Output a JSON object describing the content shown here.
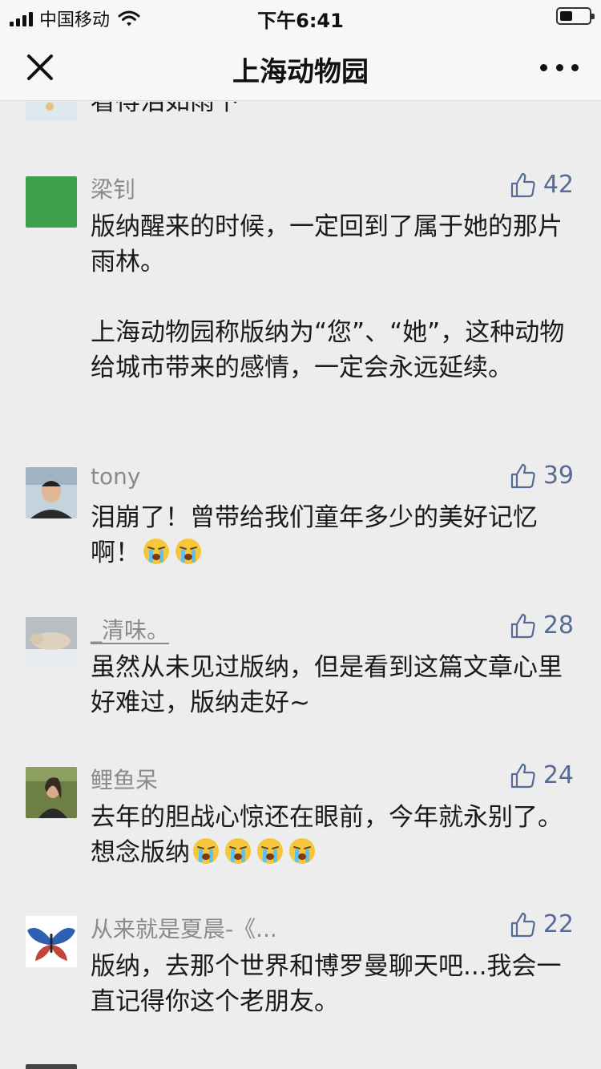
{
  "status_bar": {
    "carrier": "中国移动",
    "time": "下午6:41",
    "battery_percent": 42
  },
  "nav": {
    "title": "上海动物园"
  },
  "colors": {
    "accent": "#576b95",
    "background": "#ededed",
    "name_gray": "#8a8a8a"
  },
  "comments": [
    {
      "name": "",
      "likes": "",
      "text": "看得泪如雨下",
      "avatar_icon": "avatar-photo"
    },
    {
      "name": "梁钊",
      "likes": "42",
      "text": "版纳醒来的时候，一定回到了属于她的那片雨林。\n\n上海动物园称版纳为“您”、“她”，这种动物给城市带来的感情，一定会永远延续。",
      "avatar_icon": "green-square-avatar"
    },
    {
      "name": "tony",
      "likes": "39",
      "text": "泪崩了！曾带给我们童年多少的美好记忆啊！",
      "emoji_count": 2,
      "avatar_icon": "avatar-photo"
    },
    {
      "name": "_清味。",
      "likes": "28",
      "text": "虽然从未见过版纳，但是看到这篇文章心里好难过，版纳走好~",
      "avatar_icon": "avatar-photo"
    },
    {
      "name": "鲤鱼呆",
      "likes": "24",
      "text": "去年的胆战心惊还在眼前，今年就永别了。想念版纳",
      "emoji_count": 4,
      "avatar_icon": "avatar-photo"
    },
    {
      "name": "从来就是夏晨-《...",
      "likes": "22",
      "text": "版纳，去那个世界和博罗曼聊天吧...我会一直记得你这个老朋友。",
      "avatar_icon": "butterfly-avatar"
    }
  ]
}
